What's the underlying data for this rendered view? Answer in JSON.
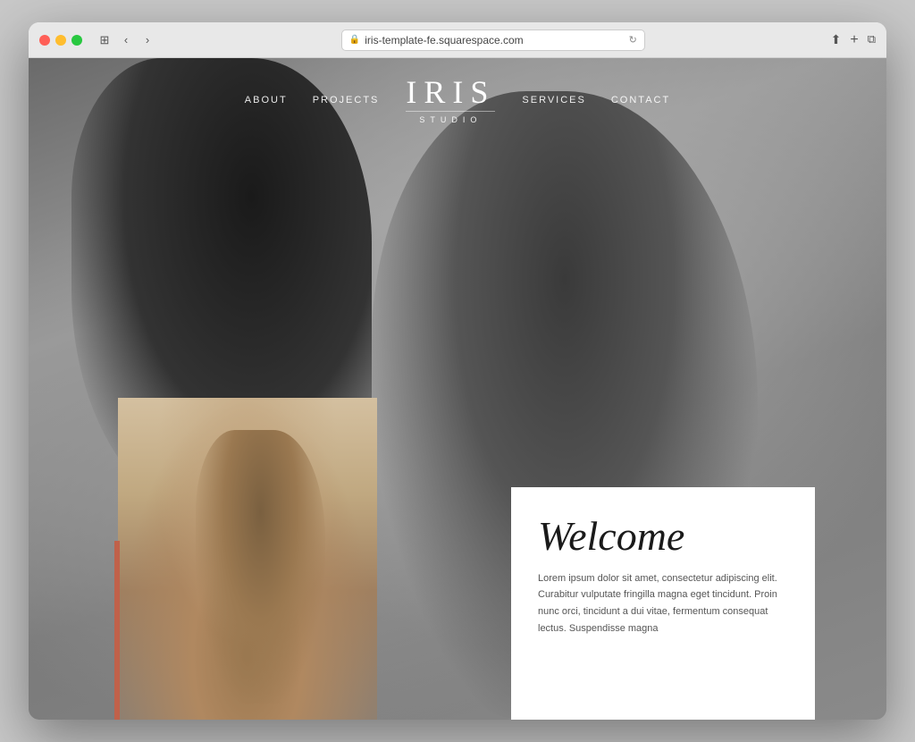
{
  "browser": {
    "address": "iris-template-fe.squarespace.com",
    "traffic_lights": [
      "close",
      "minimize",
      "maximize"
    ]
  },
  "navbar": {
    "logo_title": "IRIS",
    "logo_subtitle": "STUDIO",
    "nav_left": [
      {
        "label": "ABOUT",
        "id": "about"
      },
      {
        "label": "PROJECTS",
        "id": "projects"
      }
    ],
    "nav_right": [
      {
        "label": "SERVICES",
        "id": "services"
      },
      {
        "label": "CONTACT",
        "id": "contact"
      }
    ]
  },
  "welcome": {
    "title": "Welcome",
    "body": "Lorem ipsum dolor sit amet, consectetur adipiscing elit. Curabitur vulputate fringilla magna eget tincidunt. Proin nunc orci, tincidunt a dui vitae, fermentum consequat lectus. Suspendisse magna"
  }
}
